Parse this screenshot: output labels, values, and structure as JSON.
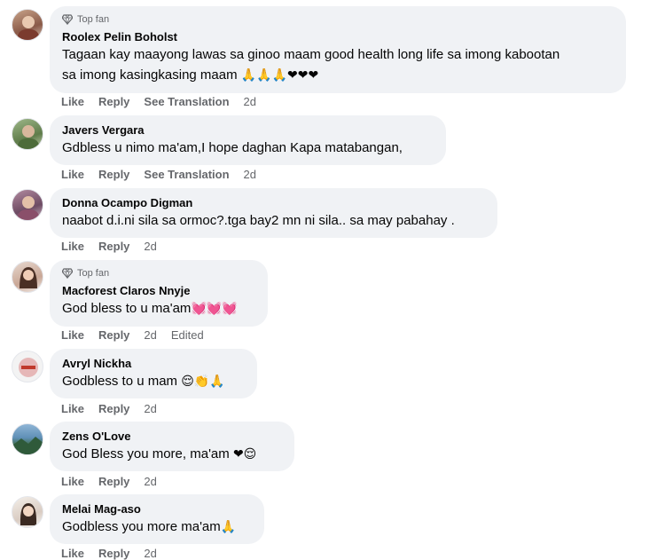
{
  "top_fan_label": "Top fan",
  "actions": {
    "like": "Like",
    "reply": "Reply",
    "see_translation": "See Translation",
    "edited": "Edited"
  },
  "comments": [
    {
      "name": "Roolex Pelin Boholst",
      "line1": "Tagaan kay maayong lawas sa ginoo maam good health long life sa imong kabootan",
      "line2": "sa imong kasingkasing maam",
      "emojis": "🙏🙏🙏❤❤❤",
      "time": "2d"
    },
    {
      "name": "Javers Vergara",
      "line1": "Gdbless u nimo ma'am,I hope daghan Kapa matabangan,",
      "time": "2d"
    },
    {
      "name": "Donna Ocampo Digman",
      "line1": "naabot d.i.ni sila sa ormoc?.tga bay2 mn ni sila.. sa may pabahay .",
      "time": "2d"
    },
    {
      "name": "Macforest Claros Nnyje",
      "line1": "God bless to u ma'am",
      "emojis": "💓💓💓",
      "time": "2d"
    },
    {
      "name": "Avryl Nickha",
      "line1": "Godbless to u mam",
      "emojis": "😌👏🙏",
      "time": "2d"
    },
    {
      "name": "Zens O'Love",
      "line1": "God Bless you more, ma'am",
      "emojis": "❤😌",
      "time": "2d"
    },
    {
      "name": "Melai Mag-aso",
      "line1": "Godbless you more ma'am",
      "emojis": "🙏",
      "time": "2d"
    }
  ],
  "colors": {
    "bubble": "#f0f2f5",
    "secondary_text": "#65676b",
    "primary_text": "#050505"
  },
  "icons": {
    "top_fan": "diamond-icon"
  }
}
